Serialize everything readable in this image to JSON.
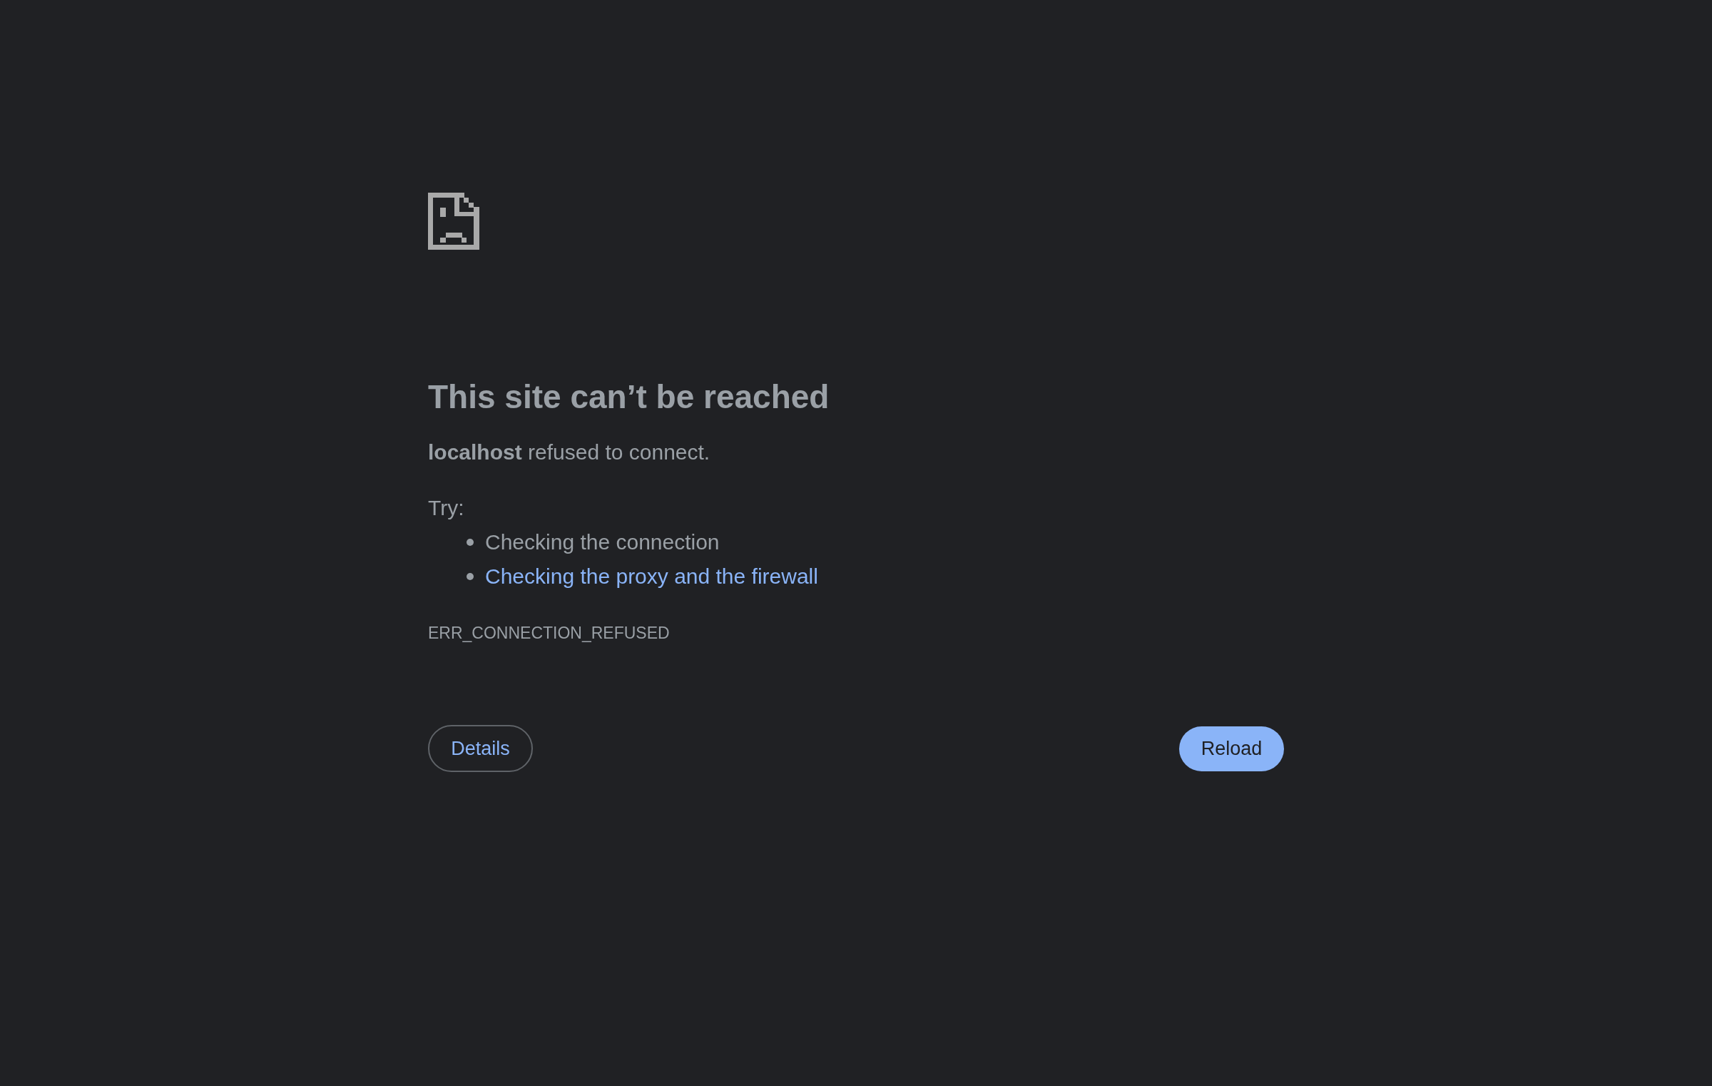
{
  "heading": "This site can’t be reached",
  "message": "**localhost** refused to connect.",
  "try_label": "Try:",
  "suggestions": [
    {
      "kind": "text",
      "text": "Checking the connection"
    },
    {
      "kind": "link",
      "text": "Checking the proxy and the firewall"
    }
  ],
  "error_code": "ERR_CONNECTION_REFUSED",
  "buttons": {
    "details": "Details",
    "reload": "Reload"
  }
}
